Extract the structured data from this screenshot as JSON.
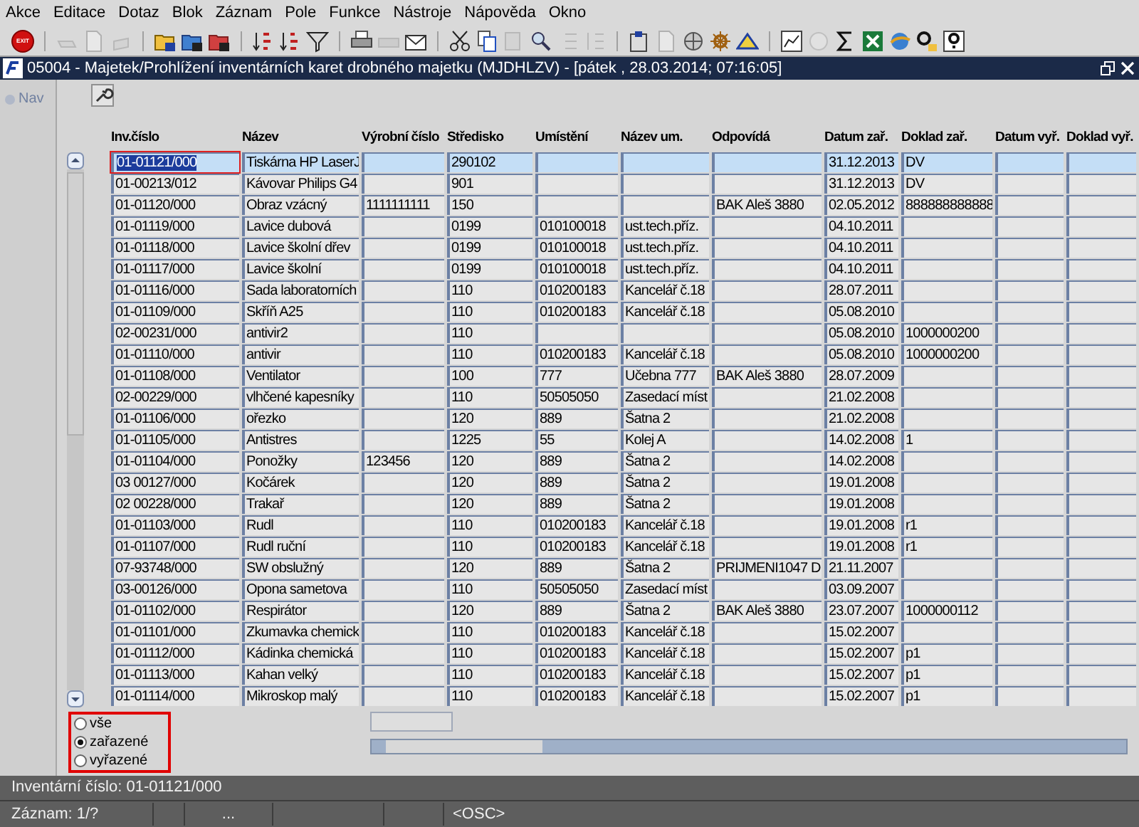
{
  "menu": [
    "Akce",
    "Editace",
    "Dotaz",
    "Blok",
    "Záznam",
    "Pole",
    "Funkce",
    "Nástroje",
    "Nápověda",
    "Okno"
  ],
  "toolbar": {
    "exit_label": "EXIT"
  },
  "window": {
    "title": "05004 - Majetek/Prohlížení inventárních karet drobného majetku (MJDHLZV) - [pátek  , 28.03.2014; 07:16:05]"
  },
  "nav": {
    "label": "Nav"
  },
  "table": {
    "columns": [
      "Inv.číslo",
      "Název",
      "Výrobní číslo",
      "Středisko",
      "Umístění",
      "Název um.",
      "Odpovídá",
      "Datum zař.",
      "Doklad zař.",
      "Datum vyř.",
      "Doklad vyř."
    ],
    "rows": [
      {
        "selected": true,
        "inv": "01-01121/000",
        "nazev": "Tiskárna HP LaserJ",
        "stredisko": "290102",
        "datum": "31.12.2013",
        "doklad": "DV"
      },
      {
        "selected": false,
        "inv": "01-00213/012",
        "nazev": "Kávovar Philips G4",
        "stredisko": "901",
        "datum": "31.12.2013",
        "doklad": "DV"
      },
      {
        "selected": false,
        "inv": "01-01120/000",
        "nazev": "Obraz vzácný",
        "vyrobni": "1111111111",
        "stredisko": "150",
        "odpovida": "BAK Aleš 3880",
        "datum": "02.05.2012",
        "doklad": "888888888888"
      },
      {
        "selected": false,
        "inv": "01-01119/000",
        "nazev": "Lavice dubová",
        "stredisko": "0199",
        "umisteni": "010100018",
        "nazev_um": "ust.tech.příz.",
        "datum": "04.10.2011"
      },
      {
        "selected": false,
        "inv": "01-01118/000",
        "nazev": "Lavice školní dřev",
        "stredisko": "0199",
        "umisteni": "010100018",
        "nazev_um": "ust.tech.příz.",
        "datum": "04.10.2011"
      },
      {
        "selected": false,
        "inv": "01-01117/000",
        "nazev": "Lavice školní",
        "stredisko": "0199",
        "umisteni": "010100018",
        "nazev_um": "ust.tech.příz.",
        "datum": "04.10.2011"
      },
      {
        "selected": false,
        "inv": "01-01116/000",
        "nazev": "Sada laboratorních",
        "stredisko": "110",
        "umisteni": "010200183",
        "nazev_um": "Kancelář č.18",
        "datum": "28.07.2011"
      },
      {
        "selected": false,
        "inv": "01-01109/000",
        "nazev": "Skříň A25",
        "stredisko": "110",
        "umisteni": "010200183",
        "nazev_um": "Kancelář č.18",
        "datum": "05.08.2010"
      },
      {
        "selected": false,
        "inv": "02-00231/000",
        "nazev": "antivir2",
        "stredisko": "110",
        "datum": "05.08.2010",
        "doklad": "1000000200"
      },
      {
        "selected": false,
        "inv": "01-01110/000",
        "nazev": "antivir",
        "stredisko": "110",
        "umisteni": "010200183",
        "nazev_um": "Kancelář č.18",
        "datum": "05.08.2010",
        "doklad": "1000000200"
      },
      {
        "selected": false,
        "inv": "01-01108/000",
        "nazev": "Ventilator",
        "stredisko": "100",
        "umisteni": "777",
        "nazev_um": "Učebna 777",
        "odpovida": "BAK Aleš 3880",
        "datum": "28.07.2009"
      },
      {
        "selected": false,
        "inv": "02-00229/000",
        "nazev": "vlhčené kapesníky",
        "stredisko": "110",
        "umisteni": "50505050",
        "nazev_um": "Zasedací míst",
        "datum": "21.02.2008"
      },
      {
        "selected": false,
        "inv": "01-01106/000",
        "nazev": "ořezko",
        "stredisko": "120",
        "umisteni": "889",
        "nazev_um": "Šatna 2",
        "datum": "21.02.2008"
      },
      {
        "selected": false,
        "inv": "01-01105/000",
        "nazev": "Antistres",
        "stredisko": "1225",
        "umisteni": "55",
        "nazev_um": "Kolej A",
        "datum": "14.02.2008",
        "doklad": "1"
      },
      {
        "selected": false,
        "inv": "01-01104/000",
        "nazev": "Ponožky",
        "vyrobni": "123456",
        "stredisko": "120",
        "umisteni": "889",
        "nazev_um": "Šatna 2",
        "datum": "14.02.2008"
      },
      {
        "selected": false,
        "inv": "03 00127/000",
        "nazev": "Kočárek",
        "stredisko": "120",
        "umisteni": "889",
        "nazev_um": "Šatna 2",
        "datum": "19.01.2008"
      },
      {
        "selected": false,
        "inv": "02 00228/000",
        "nazev": "Trakař",
        "stredisko": "120",
        "umisteni": "889",
        "nazev_um": "Šatna 2",
        "datum": "19.01.2008"
      },
      {
        "selected": false,
        "inv": "01-01103/000",
        "nazev": "Rudl",
        "stredisko": "110",
        "umisteni": "010200183",
        "nazev_um": "Kancelář č.18",
        "datum": "19.01.2008",
        "doklad": "r1"
      },
      {
        "selected": false,
        "inv": "01-01107/000",
        "nazev": "Rudl ruční",
        "stredisko": "110",
        "umisteni": "010200183",
        "nazev_um": "Kancelář č.18",
        "datum": "19.01.2008",
        "doklad": "r1"
      },
      {
        "selected": false,
        "inv": "07-93748/000",
        "nazev": "SW obslužný",
        "stredisko": "120",
        "umisteni": "889",
        "nazev_um": "Šatna 2",
        "odpovida": "PRIJMENI1047 D",
        "datum": "21.11.2007"
      },
      {
        "selected": false,
        "inv": "03-00126/000",
        "nazev": "Opona sametova",
        "stredisko": "110",
        "umisteni": "50505050",
        "nazev_um": "Zasedací míst",
        "datum": "03.09.2007"
      },
      {
        "selected": false,
        "inv": "01-01102/000",
        "nazev": "Respirátor",
        "stredisko": "120",
        "umisteni": "889",
        "nazev_um": "Šatna 2",
        "odpovida": "BAK Aleš 3880",
        "datum": "23.07.2007",
        "doklad": "1000000112"
      },
      {
        "selected": false,
        "inv": "01-01101/000",
        "nazev": "Zkumavka chemick",
        "stredisko": "110",
        "umisteni": "010200183",
        "nazev_um": "Kancelář č.18",
        "datum": "15.02.2007"
      },
      {
        "selected": false,
        "inv": "01-01112/000",
        "nazev": "Kádinka chemická",
        "stredisko": "110",
        "umisteni": "010200183",
        "nazev_um": "Kancelář č.18",
        "datum": "15.02.2007",
        "doklad": "p1"
      },
      {
        "selected": false,
        "inv": "01-01113/000",
        "nazev": "Kahan velký",
        "stredisko": "110",
        "umisteni": "010200183",
        "nazev_um": "Kancelář č.18",
        "datum": "15.02.2007",
        "doklad": "p1"
      },
      {
        "selected": false,
        "inv": "01-01114/000",
        "nazev": "Mikroskop malý",
        "stredisko": "110",
        "umisteni": "010200183",
        "nazev_um": "Kancelář č.18",
        "datum": "15.02.2007",
        "doklad": "p1"
      }
    ]
  },
  "filter": [
    {
      "label": "vše",
      "selected": false
    },
    {
      "label": "zařazené",
      "selected": true
    },
    {
      "label": "vyřazené",
      "selected": false
    }
  ],
  "status_bar": {
    "message": "Inventární číslo: 01-01121/000",
    "record": "Záznam: 1/?",
    "field_3": "...",
    "mode": "<OSC>"
  }
}
